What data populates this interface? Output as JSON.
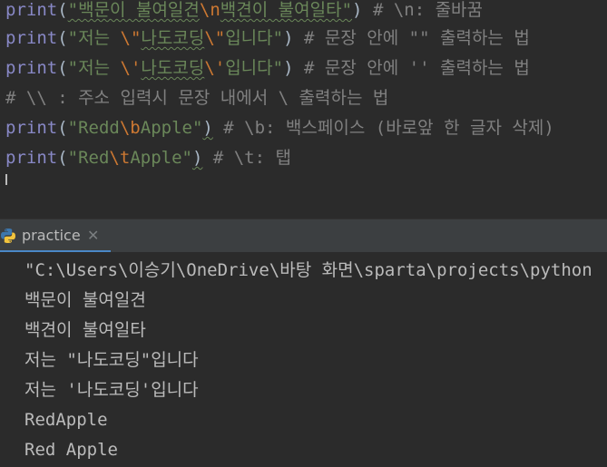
{
  "editor": {
    "lines": [
      {
        "kw": "print",
        "open": "(",
        "s1": "\"백문이 불여일견",
        "e1": "\\n",
        "s2": "백견이 불여일타\"",
        "close": ")",
        "comment": " # \\n: 줄바꿈"
      },
      {
        "kw": "print",
        "open": "(",
        "s1": "\"저는 ",
        "e1": "\\\"",
        "s2": "나도코딩",
        "e2": "\\\"",
        "s3": "입니다\"",
        "close": ")",
        "comment": " # 문장 안에 \"\" 출력하는 법"
      },
      {
        "kw": "print",
        "open": "(",
        "s1": "\"저는 ",
        "e1": "\\'",
        "s2": "나도코딩",
        "e2": "\\'",
        "s3": "입니다\"",
        "close": ")",
        "comment": " # 문장 안에 '' 출력하는 법"
      },
      {
        "comment": "# \\\\ : 주소 입력시 문장 내에서 \\ 출력하는 법"
      },
      {
        "kw": "print",
        "open": "(",
        "s1": "\"Redd",
        "e1": "\\b",
        "s2": "Apple\"",
        "close": ")",
        "comment": " # \\b: 백스페이스 (바로앞 한 글자 삭제)"
      },
      {
        "kw": "print",
        "open": "(",
        "s1": "\"Red",
        "e1": "\\t",
        "s2": "Apple\"",
        "close": ")",
        "comment": " # \\t: 탭"
      }
    ]
  },
  "run_panel": {
    "tab_label": "practice",
    "close_glyph": "✕"
  },
  "console": {
    "lines": [
      "\"C:\\Users\\이승기\\OneDrive\\바탕 화면\\sparta\\projects\\python",
      "백문이 불여일견",
      "백견이 불여일타",
      "저는 \"나도코딩\"입니다",
      "저는 '나도코딩'입니다",
      "RedApple",
      "Red Apple"
    ]
  }
}
